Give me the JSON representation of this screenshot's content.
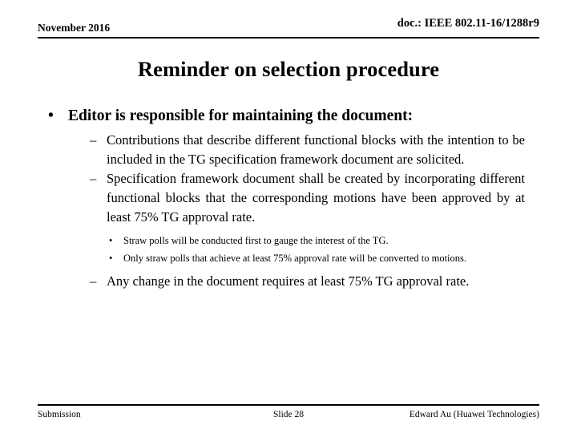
{
  "header": {
    "date": "November 2016",
    "doc_id": "doc.: IEEE 802.11-16/1288r9"
  },
  "title": "Reminder on selection procedure",
  "body": {
    "bullet_mark_level1": "•",
    "bullet_mark_level2": "–",
    "bullet_mark_level3": "•",
    "level1": "Editor is responsible for maintaining the document:",
    "level2_items": [
      "Contributions that describe different functional blocks with the intention to be included in the TG specification framework document are solicited.",
      "Specification framework document shall be created by incorporating different functional blocks that the corresponding motions have been approved by at least 75% TG approval rate."
    ],
    "level3_items": [
      "Straw polls will be conducted first to gauge the interest of the TG.",
      "Only straw polls that achieve at least 75% approval rate will be converted to motions."
    ],
    "level2_last": "Any change in the document requires at least 75% TG approval rate."
  },
  "footer": {
    "left": "Submission",
    "center": "Slide 28",
    "right": "Edward Au (Huawei Technologies)"
  }
}
